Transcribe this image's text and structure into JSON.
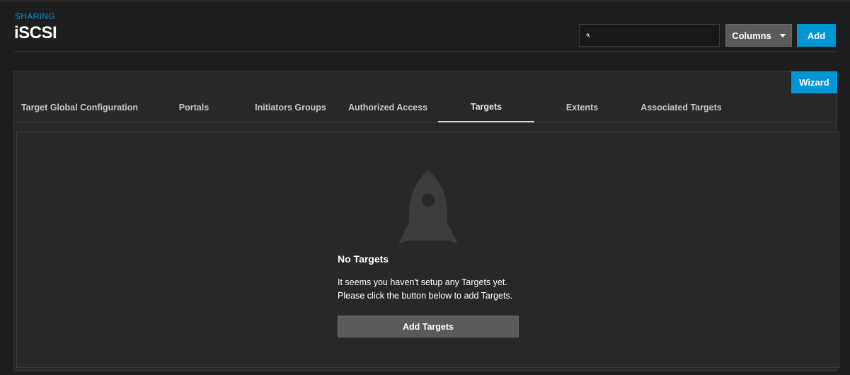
{
  "header": {
    "breadcrumb": "SHARING",
    "title": "iSCSI",
    "search": {
      "value": "",
      "placeholder": "",
      "icon": "search-icon"
    },
    "columns_label": "Columns",
    "add_label": "Add"
  },
  "wizard_label": "Wizard",
  "tabs": [
    {
      "label": "Target Global Configuration",
      "active": false
    },
    {
      "label": "Portals",
      "active": false
    },
    {
      "label": "Initiators Groups",
      "active": false
    },
    {
      "label": "Authorized Access",
      "active": false
    },
    {
      "label": "Targets",
      "active": true
    },
    {
      "label": "Extents",
      "active": false
    },
    {
      "label": "Associated Targets",
      "active": false
    }
  ],
  "empty_state": {
    "icon": "rocket-icon",
    "title": "No Targets",
    "message_line1": "It seems you haven't setup any Targets yet.",
    "message_line2": "Please click the button below to add Targets.",
    "button_label": "Add Targets"
  },
  "colors": {
    "accent": "#0095d5",
    "background": "#1e1e1e",
    "card": "#282828",
    "button_gray": "#5b5b5b"
  }
}
